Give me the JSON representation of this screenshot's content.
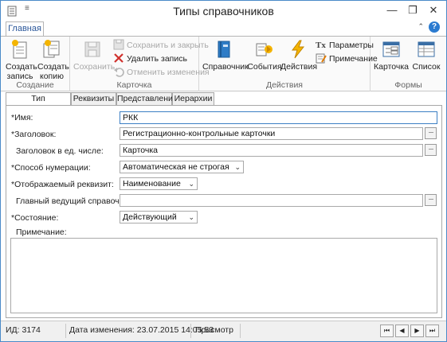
{
  "window": {
    "title": "Типы справочников",
    "minimize_glyph": "—",
    "restore_glyph": "❐",
    "close_glyph": "✕",
    "quick_access_glyph": "≡",
    "app_icon": "document-app-icon"
  },
  "ribbon": {
    "active_tab": "Главная",
    "help_glyph": "?",
    "collapse_glyph": "⌃",
    "groups": {
      "create": {
        "label": "Создание",
        "new_record": "Создать\nзапись",
        "new_record_l1": "Создать",
        "new_record_l2": "запись",
        "copy_l1": "Создать",
        "copy_l2": "копию"
      },
      "card": {
        "label": "Карточка",
        "save": "Сохранить",
        "save_close": "Сохранить и закрыть",
        "delete": "Удалить запись",
        "cancel_changes": "Отменить изменения"
      },
      "actions": {
        "label": "Действия",
        "reference": "Справочник",
        "events": "События",
        "actions": "Действия",
        "parameters": "Параметры",
        "note": "Примечание"
      },
      "forms": {
        "label": "Формы",
        "card": "Карточка",
        "list": "Список"
      }
    }
  },
  "form_tabs": [
    "Тип справочника",
    "Реквизиты",
    "Представления",
    "Иерархии"
  ],
  "form": {
    "name_label": "*Имя:",
    "name_value": "РКК",
    "heading_label": "*Заголовок:",
    "heading_value": "Регистрационно-контрольные карточки",
    "heading_singular_label": "Заголовок в ед. числе:",
    "heading_singular_value": "Карточка",
    "numbering_label": "*Способ нумерации:",
    "numbering_value": "Автоматическая не строгая",
    "display_attr_label": "*Отображаемый реквизит:",
    "display_attr_value": "Наименование",
    "master_ref_label": "Главный ведущий справочник:",
    "master_ref_value": "",
    "state_label": "*Состояние:",
    "state_value": "Действующий",
    "note_label": "Примечание:",
    "note_value": "",
    "ellipsis": "···",
    "dropdown_glyph": "⌄"
  },
  "status": {
    "id": "ИД: 3174",
    "modified": "Дата изменения: 23.07.2015 14:05:53",
    "mode": "Просмотр",
    "nav_first": "⏮",
    "nav_prev": "◀",
    "nav_next": "▶",
    "nav_last": "⏭"
  }
}
